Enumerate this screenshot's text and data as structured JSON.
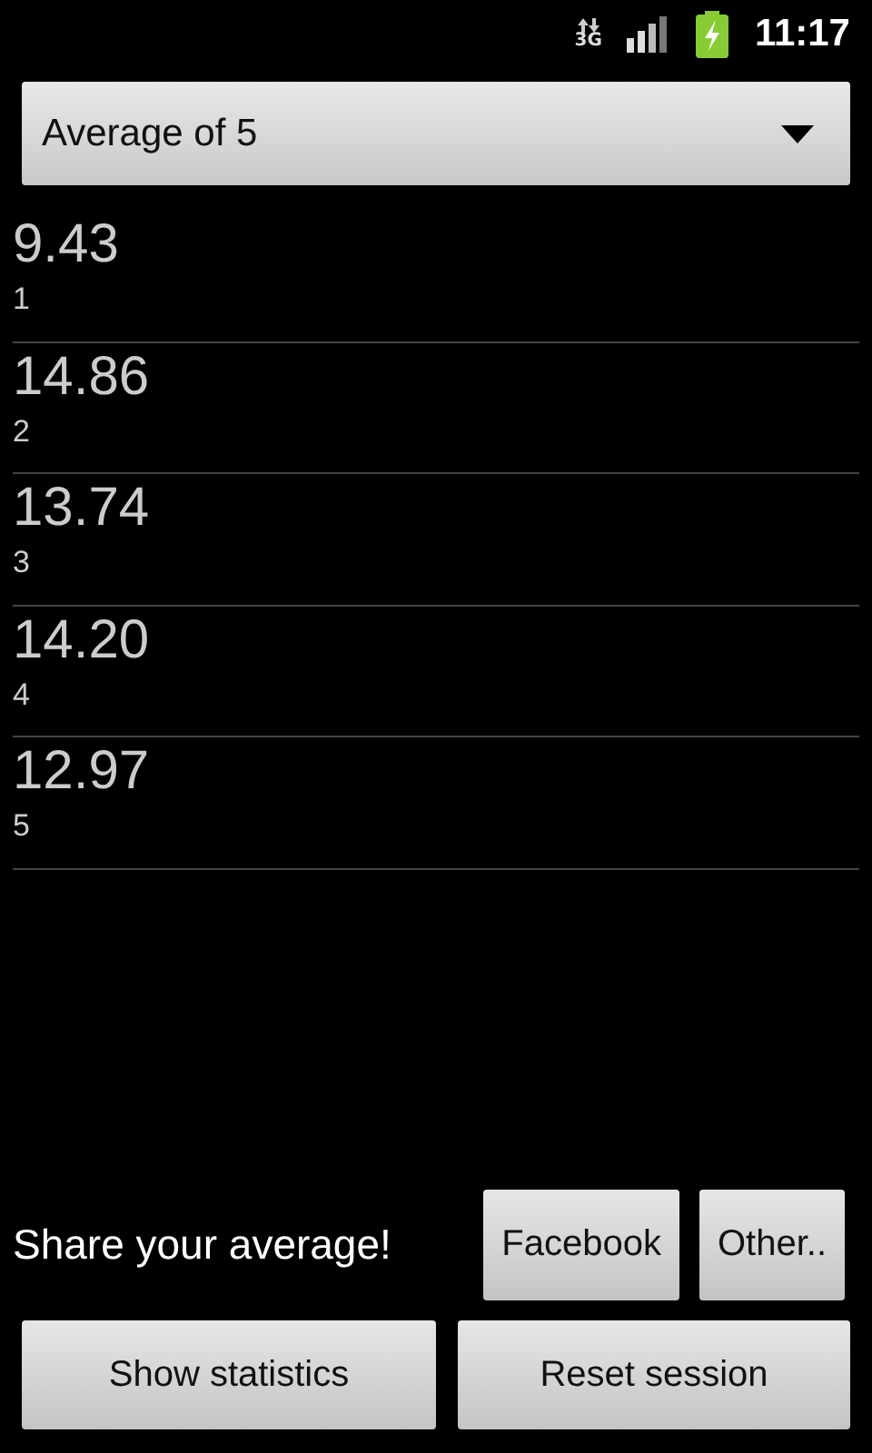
{
  "status_bar": {
    "network": "3G",
    "time": "11:17"
  },
  "dropdown": {
    "value": "Average of 5"
  },
  "times": [
    {
      "value": "9.43",
      "index": "1"
    },
    {
      "value": "14.86",
      "index": "2"
    },
    {
      "value": "13.74",
      "index": "3"
    },
    {
      "value": "14.20",
      "index": "4"
    },
    {
      "value": "12.97",
      "index": "5"
    }
  ],
  "share": {
    "label": "Share your average!",
    "buttons": [
      "Facebook",
      "Other.."
    ]
  },
  "buttons": [
    "Show statistics",
    "Reset session"
  ]
}
